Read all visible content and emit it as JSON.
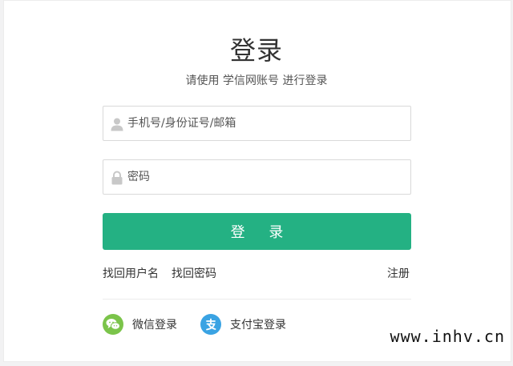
{
  "header": {
    "title": "登录",
    "subtitle": "请使用 学信网账号 进行登录"
  },
  "form": {
    "account": {
      "value": "",
      "placeholder": "手机号/身份证号/邮箱",
      "icon": "user-icon"
    },
    "password": {
      "value": "",
      "placeholder": "密码",
      "icon": "lock-icon"
    },
    "login_label": "登 录"
  },
  "links": {
    "find_username": "找回用户名",
    "find_password": "找回密码",
    "register": "注册"
  },
  "social": {
    "wechat": {
      "label": "微信登录",
      "icon": "wechat-icon",
      "color": "#7bc44a"
    },
    "alipay": {
      "label": "支付宝登录",
      "icon": "alipay-icon",
      "color": "#3aa3e3"
    }
  },
  "colors": {
    "accent": "#24b183"
  },
  "watermark": "www.inhv.cn"
}
